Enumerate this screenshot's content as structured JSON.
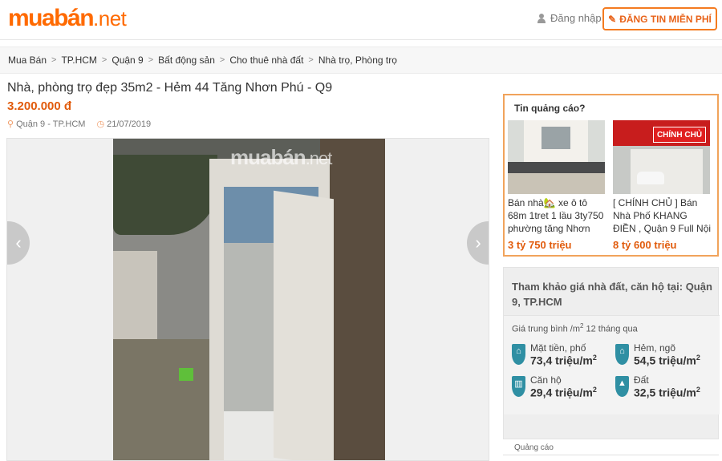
{
  "header": {
    "logo_main": "muabán",
    "logo_tld": ".net",
    "login_label": "Đăng nhập",
    "post_button": "ĐĂNG TIN MIỄN PHÍ"
  },
  "breadcrumb": [
    "Mua Bán",
    "TP.HCM",
    "Quận 9",
    "Bất động sản",
    "Cho thuê nhà đất",
    "Nhà trọ, Phòng trọ"
  ],
  "listing": {
    "title": "Nhà, phòng trọ đẹp 35m2 - Hẻm 44 Tăng Nhơn Phú - Q9",
    "price": "3.200.000 đ",
    "location": "Quận 9 - TP.HCM",
    "date": "21/07/2019",
    "watermark_main": "muabán",
    "watermark_tld": ".net"
  },
  "gallery": {
    "prev_icon": "chevron-left-icon",
    "next_icon": "chevron-right-icon"
  },
  "ads": {
    "title": "Tin quảng cáo?",
    "items": [
      {
        "text": "Bán nhà🏡 xe ô tô 68m 1tret 1 lầu 3ty750 phường tăng Nhơn",
        "price": "3 tỷ 750 triệu"
      },
      {
        "text": "[ CHÍNH CHỦ ] Bán Nhà Phố KHANG ĐIỀN , Quận 9 Full Nội",
        "price": "8 tỷ 600 triệu",
        "badge": "CHÍNH CHỦ"
      }
    ]
  },
  "price_reference": {
    "title": "Tham khảo giá nhà đất, căn hộ tại: Quận 9, TP.HCM",
    "subtitle_prefix": "Giá trung bình /m",
    "subtitle_sup": "2",
    "subtitle_suffix": " 12 tháng qua",
    "stats": [
      {
        "label": "Mặt tiền, phố",
        "value": "73,4 triệu/m",
        "sup": "2"
      },
      {
        "label": "Hẻm, ngõ",
        "value": "54,5 triệu/m",
        "sup": "2"
      },
      {
        "label": "Căn hộ",
        "value": "29,4 triệu/m",
        "sup": "2"
      },
      {
        "label": "Đất",
        "value": "32,5 triệu/m",
        "sup": "2"
      }
    ]
  },
  "footer_ad_label": "Quảng cáo",
  "colors": {
    "brand": "#ff6a00",
    "price": "#e15b0c",
    "accent_border": "#f1a35b",
    "icon_teal": "#2f8fa3"
  }
}
